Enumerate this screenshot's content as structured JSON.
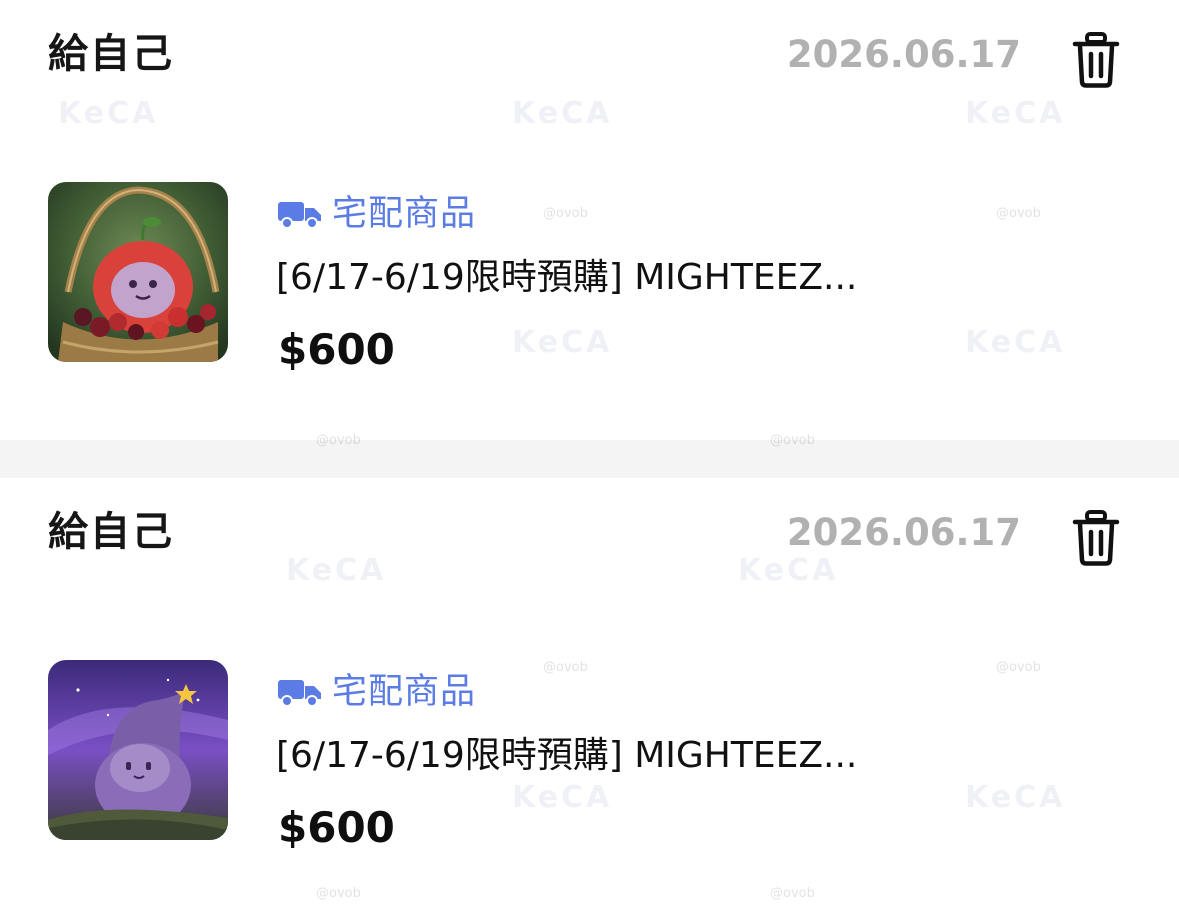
{
  "orders": [
    {
      "recipient": "給自己",
      "date": "2026.06.17",
      "delivery_label": "宅配商品",
      "product_name": "[6/17-6/19限時預購] MIGHTEEZ...",
      "price": "$600",
      "thumb_theme": "cherry-basket"
    },
    {
      "recipient": "給自己",
      "date": "2026.06.17",
      "delivery_label": "宅配商品",
      "product_name": "[6/17-6/19限時預購] MIGHTEEZ...",
      "price": "$600",
      "thumb_theme": "purple-night"
    }
  ],
  "watermarks": {
    "brand": "KeCA",
    "handle": "@ovob"
  },
  "icons": {
    "delete": "trash-icon",
    "delivery": "delivery-truck-icon"
  },
  "colors": {
    "delivery_accent": "#5b7ce4",
    "date_gray": "#b1b1b1",
    "text_dark": "#111111",
    "divider": "#f4f4f5"
  }
}
